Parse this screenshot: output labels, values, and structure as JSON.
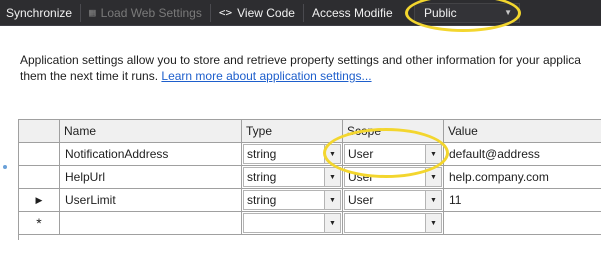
{
  "toolbar": {
    "synchronize_label": "Synchronize",
    "load_web_settings_label": "Load Web Settings",
    "view_code_label": "View Code",
    "access_modifier_label": "Access Modifie",
    "access_modifier_value": "Public"
  },
  "description": {
    "text_line1": "Application settings allow you to store and retrieve property settings and other information for your applica",
    "text_line2": "them the next time it runs.",
    "link": "Learn more about application settings..."
  },
  "grid": {
    "columns": [
      "Name",
      "Type",
      "Scope",
      "Value"
    ],
    "rows": [
      {
        "name": "NotificationAddress",
        "type": "string",
        "scope": "User",
        "value": "default@address"
      },
      {
        "name": "HelpUrl",
        "type": "string",
        "scope": "User",
        "value": "help.company.com"
      },
      {
        "name": "UserLimit",
        "type": "string",
        "scope": "User",
        "value": "11",
        "indicator": "▶"
      },
      {
        "name": "",
        "type": "",
        "scope": "",
        "value": "",
        "indicator": "*"
      }
    ]
  },
  "colors": {
    "toolbar_bg": "#2d2d30",
    "highlight": "#f3d62e",
    "link": "#1e5fcc"
  }
}
